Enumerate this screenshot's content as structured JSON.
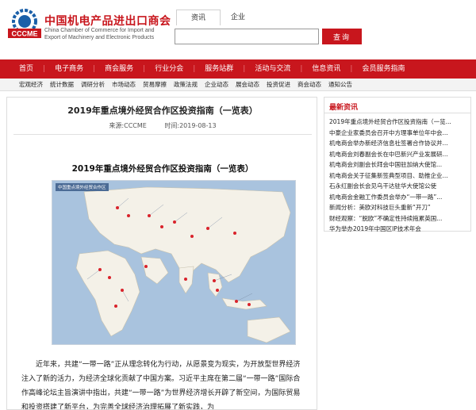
{
  "header": {
    "logo_text": "CCCME",
    "name_cn": "中国机电产品进出口商会",
    "name_en_1": "China Chamber of Commerce for Import and",
    "name_en_2": "Export of Machinery and Electronic Products"
  },
  "search": {
    "tabs": [
      "资讯",
      "企业"
    ],
    "active_tab": "资讯",
    "value": "",
    "placeholder": "",
    "button_label": "查询"
  },
  "nav": {
    "items": [
      "首页",
      "电子商务",
      "商会服务",
      "行业分会",
      "服务站群",
      "活动与交流",
      "信息资讯",
      "会员服务指南"
    ]
  },
  "subnav": {
    "items": [
      "宏观经济",
      "统计数据",
      "调研分析",
      "市场动态",
      "贸易摩擦",
      "政策法规",
      "企业动态",
      "展会动态",
      "投资促进",
      "商会动态",
      "通知公告"
    ]
  },
  "article": {
    "title": "2019年重点境外经贸合作区投资指南（一览表）",
    "source": "来源:CCCME",
    "time": "时间:2019-08-13",
    "content_title": "2019年重点境外经贸合作区投资指南（一览表）",
    "map_caption": "中国重点境外经贸合作区",
    "paragraph": "近年来，共建“一带一路”正从理念转化为行动，从愿景变为现实，为开放型世界经济注入了新的活力，为经济全球化贡献了中国方案。习近平主席在第二届“一带一路”国际合作高峰论坛主旨演讲中指出，共建“一带一路”为世界经济增长开辟了新空间，为国际贸易和投资搭建了新平台，为完善全球经济治理拓展了新实践，为"
  },
  "sidebar": {
    "title": "最新资讯",
    "items": [
      "2019年重点境外经贸合作区投资指南（一览...",
      "中豪企业家委员会召开中方理事单位年中会...",
      "机电商会举办新经济信息社签署合作协议并...",
      "机电商会刘春副会长在中巴新兴产业发展研...",
      "机电商会刘副会长拜会中国驻加纳大使馆...",
      "机电商会关于征集新签典型项目、助推企业...",
      "石永红副会长会见乌干达驻华大使馆公使",
      "机电商会金融工作委员会举办“一带一路”...",
      "新闻分析：美欧对科技巨头重新“开刀”",
      "财经观察：“脱欧”不确定性持续拖累英国...",
      "华为举办2019年中国区IP技术年会"
    ]
  },
  "colors": {
    "brand_red": "#c8161d",
    "map_land": "#f4f1e8",
    "map_water": "#a9c3de",
    "pin": "#d9232b"
  }
}
